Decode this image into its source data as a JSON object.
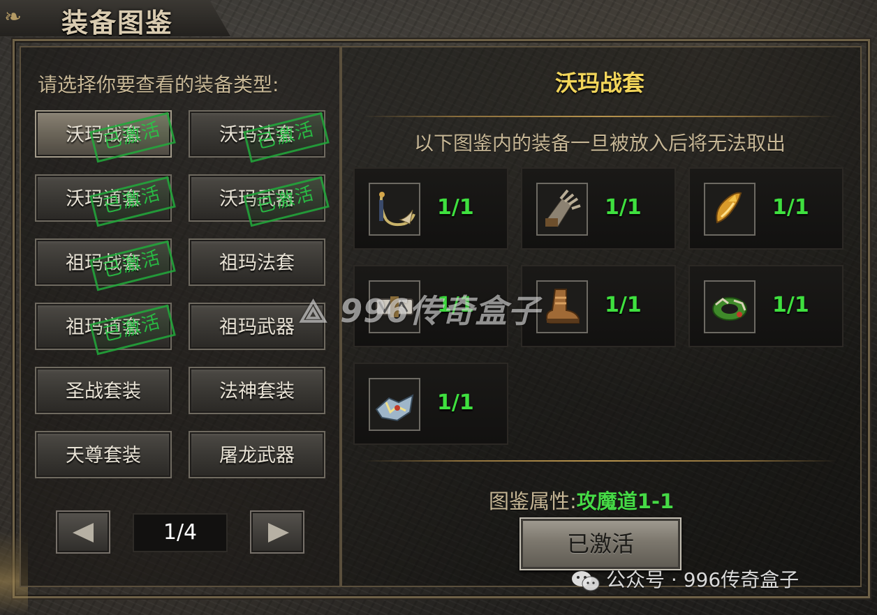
{
  "window": {
    "title": "装备图鉴"
  },
  "left_panel": {
    "prompt": "请选择你要查看的装备类型:",
    "categories": [
      {
        "label": "沃玛战套",
        "activated": true,
        "selected": true
      },
      {
        "label": "沃玛法套",
        "activated": true,
        "selected": false
      },
      {
        "label": "沃玛道套",
        "activated": true,
        "selected": false
      },
      {
        "label": "沃玛武器",
        "activated": true,
        "selected": false
      },
      {
        "label": "祖玛战套",
        "activated": true,
        "selected": false
      },
      {
        "label": "祖玛法套",
        "activated": false,
        "selected": false
      },
      {
        "label": "祖玛道套",
        "activated": true,
        "selected": false
      },
      {
        "label": "祖玛武器",
        "activated": false,
        "selected": false
      },
      {
        "label": "圣战套装",
        "activated": false,
        "selected": false
      },
      {
        "label": "法神套装",
        "activated": false,
        "selected": false
      },
      {
        "label": "天尊套装",
        "activated": false,
        "selected": false
      },
      {
        "label": "屠龙武器",
        "activated": false,
        "selected": false
      }
    ],
    "stamp_text": "已激活",
    "pagination": {
      "page": "1/4",
      "prev_icon": "triangle-left-icon",
      "next_icon": "triangle-right-icon"
    }
  },
  "right_panel": {
    "set_title": "沃玛战套",
    "notice": "以下图鉴内的装备一旦被放入后将无法取出",
    "items": [
      {
        "icon": "necklace-icon",
        "count": "1/1"
      },
      {
        "icon": "gauntlet-icon",
        "count": "1/1"
      },
      {
        "icon": "ring-icon",
        "count": "1/1"
      },
      {
        "icon": "belt-icon",
        "count": "1/1"
      },
      {
        "icon": "boots-icon",
        "count": "1/1"
      },
      {
        "icon": "bracelet-icon",
        "count": "1/1"
      },
      {
        "icon": "armor-icon",
        "count": "1/1"
      }
    ],
    "attribute_label": "图鉴属性:",
    "attribute_value": "攻魔道1-1",
    "activate_button": "已激活"
  },
  "watermarks": {
    "center": "996传奇盒子",
    "bottom": "公众号 · 996传奇盒子"
  },
  "colors": {
    "set_title": "#f2d55a",
    "count": "#3fe03f",
    "stamp": "#28c846",
    "text": "#c7b796"
  }
}
